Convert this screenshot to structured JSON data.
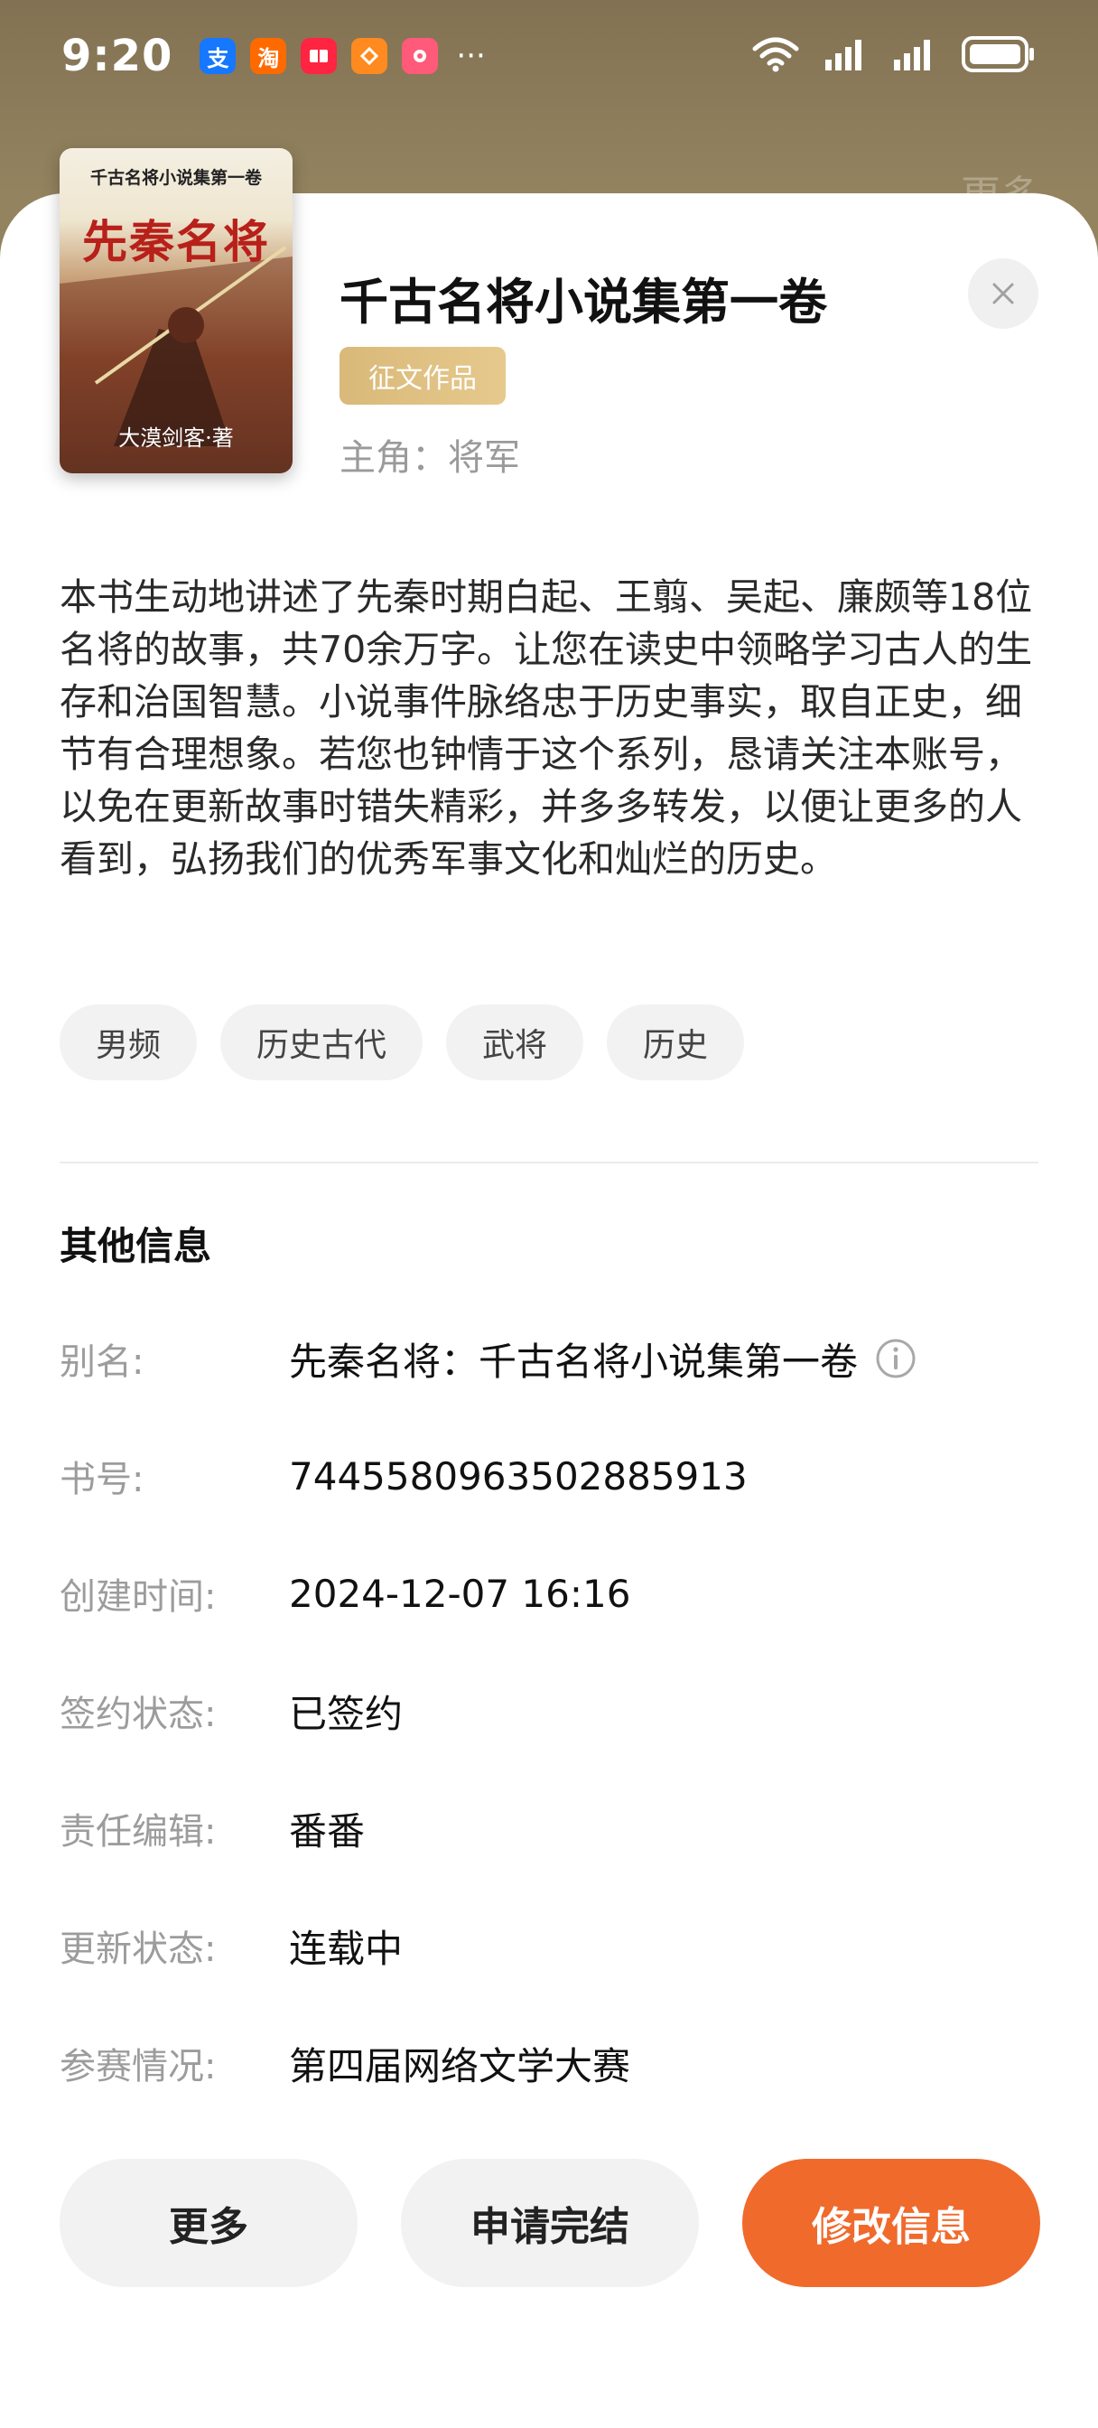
{
  "status_bar": {
    "time": "9:20",
    "apps": [
      {
        "name": "alipay-icon",
        "glyph": "支",
        "color": "#1677ff"
      },
      {
        "name": "taobao-icon",
        "glyph": "淘",
        "color": "#ff6a00"
      },
      {
        "name": "red-book-icon",
        "glyph": "",
        "color": "#ff2442"
      },
      {
        "name": "orange-app-icon",
        "glyph": "",
        "color": "#ff8a1f"
      },
      {
        "name": "pink-app-icon",
        "glyph": "",
        "color": "#ff5a79"
      }
    ],
    "more_dots": "···"
  },
  "background": {
    "more_label": "更多"
  },
  "book": {
    "cover": {
      "series_text": "千古名将小说集第一卷",
      "title_text": "先秦名将",
      "author_text": "大漠剑客·著"
    },
    "title": "千古名将小说集第一卷",
    "badge": "征文作品",
    "protagonist": "主角：将军",
    "description": "本书生动地讲述了先秦时期白起、王翦、吴起、廉颇等18位名将的故事，共70余万字。让您在读史中领略学习古人的生存和治国智慧。小说事件脉络忠于历史事实，取自正史，细节有合理想象。若您也钟情于这个系列，恳请关注本账号，以免在更新故事时错失精彩，并多多转发，以便让更多的人看到，弘扬我们的优秀军事文化和灿烂的历史。",
    "tags": [
      "男频",
      "历史古代",
      "武将",
      "历史"
    ]
  },
  "other_info": {
    "title": "其他信息",
    "rows": [
      {
        "label": "别名:",
        "value": "先秦名将：千古名将小说集第一卷"
      },
      {
        "label": "书号:",
        "value": "7445580963502885913"
      },
      {
        "label": "创建时间:",
        "value": "2024-12-07 16:16"
      },
      {
        "label": "签约状态:",
        "value": "已签约"
      },
      {
        "label": "责任编辑:",
        "value": "番番"
      },
      {
        "label": "更新状态:",
        "value": "连载中"
      },
      {
        "label": "参赛情况:",
        "value": "第四届网络文学大赛"
      }
    ]
  },
  "actions": {
    "more": "更多",
    "apply_finish": "申请完结",
    "edit_info": "修改信息"
  },
  "colors": {
    "accent": "#f06a2c",
    "badge": "#dcbc7e"
  }
}
